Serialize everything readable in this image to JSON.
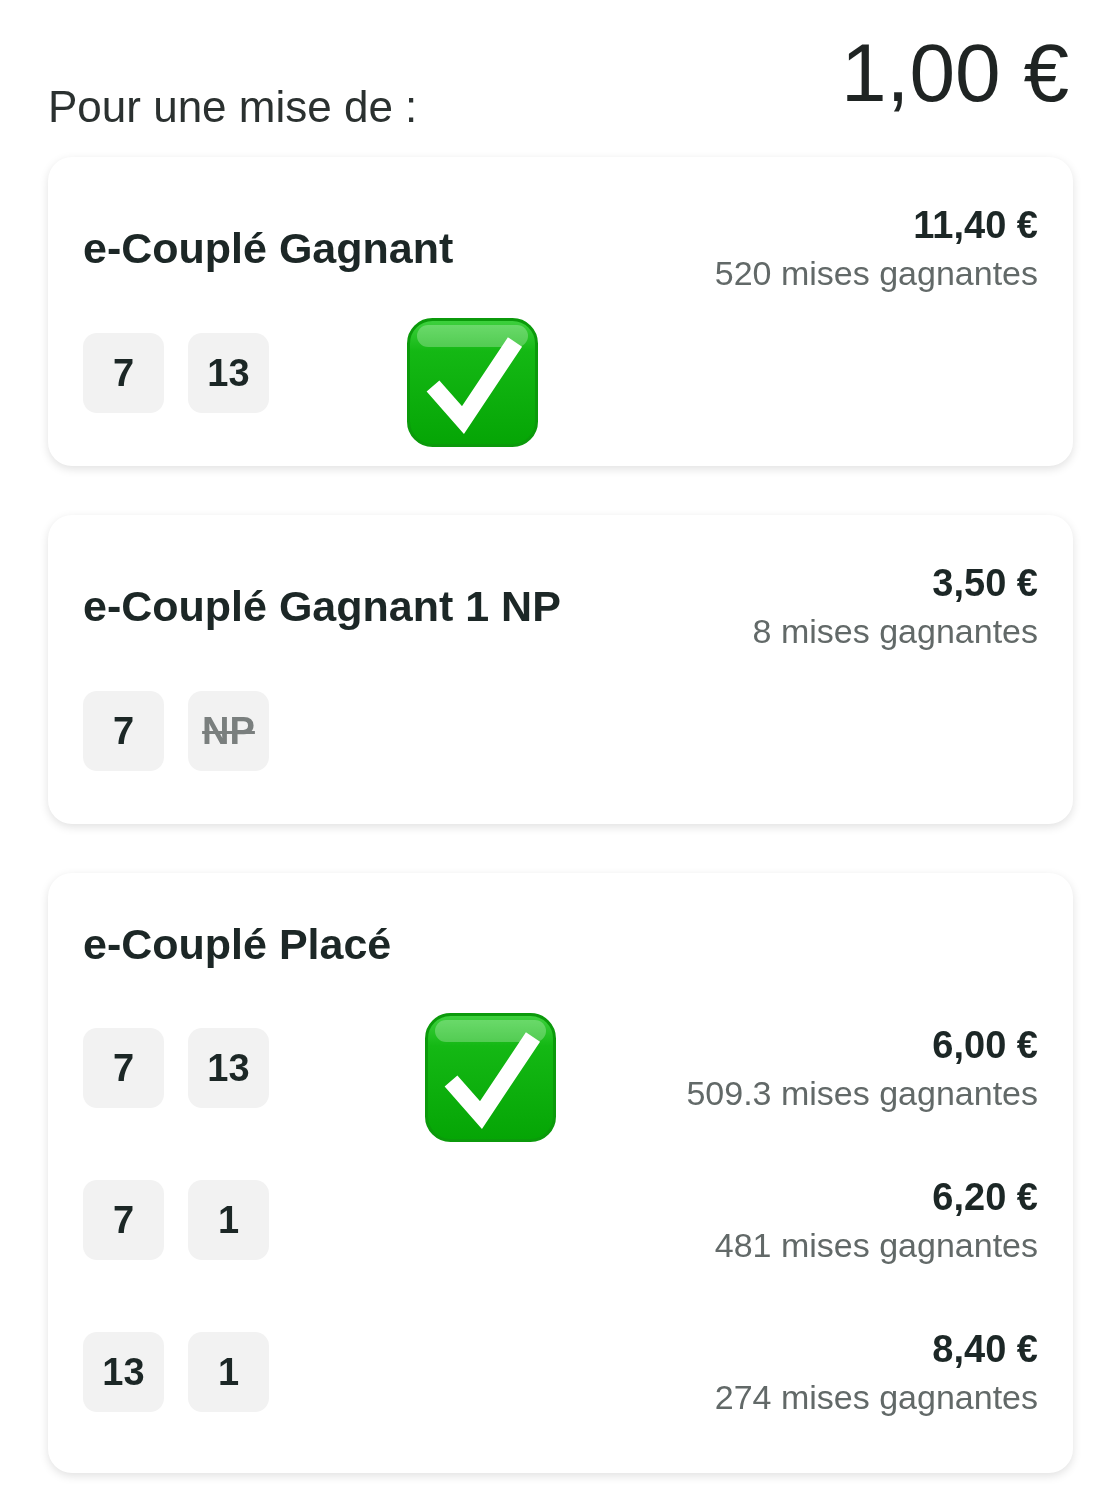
{
  "stake": {
    "label": "Pour une mise de :",
    "amount": "1,00 €"
  },
  "bets": [
    {
      "kind": "single",
      "title": "e-Couplé Gagnant",
      "payout": "11,40 €",
      "winners": "520 mises gagnantes",
      "combinations": [
        {
          "numbers": [
            {
              "text": "7",
              "scratched": false
            },
            {
              "text": "13",
              "scratched": false
            }
          ],
          "winner": true
        }
      ]
    },
    {
      "kind": "single",
      "title": "e-Couplé Gagnant 1 NP",
      "payout": "3,50 €",
      "winners": "8 mises gagnantes",
      "combinations": [
        {
          "numbers": [
            {
              "text": "7",
              "scratched": false
            },
            {
              "text": "NP",
              "scratched": true
            }
          ],
          "winner": false
        }
      ]
    },
    {
      "kind": "rows",
      "title": "e-Couplé Placé",
      "combinations": [
        {
          "numbers": [
            {
              "text": "7",
              "scratched": false
            },
            {
              "text": "13",
              "scratched": false
            }
          ],
          "winner": true,
          "payout": "6,00 €",
          "winners": "509.3 mises gagnantes"
        },
        {
          "numbers": [
            {
              "text": "7",
              "scratched": false
            },
            {
              "text": "1",
              "scratched": false
            }
          ],
          "winner": false,
          "payout": "6,20 €",
          "winners": "481 mises gagnantes"
        },
        {
          "numbers": [
            {
              "text": "13",
              "scratched": false
            },
            {
              "text": "1",
              "scratched": false
            }
          ],
          "winner": false,
          "payout": "8,40 €",
          "winners": "274 mises gagnantes"
        }
      ]
    }
  ]
}
